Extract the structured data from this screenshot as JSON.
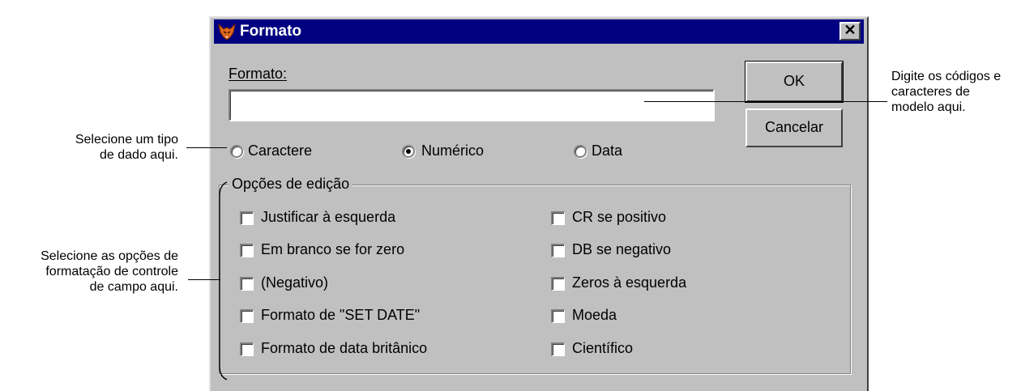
{
  "dialog": {
    "title": "Formato",
    "close_glyph": "✕",
    "format_label": "Formato:",
    "format_value": "",
    "ok_label": "OK",
    "cancel_label": "Cancelar",
    "radios": [
      {
        "label": "Caractere",
        "selected": false
      },
      {
        "label": "Numérico",
        "selected": true
      },
      {
        "label": "Data",
        "selected": false
      }
    ],
    "group_title": "Opções de edição",
    "options_left": [
      {
        "label": "Justificar à esquerda",
        "checked": false
      },
      {
        "label": "Em branco se for zero",
        "checked": false
      },
      {
        "label": "(Negativo)",
        "checked": false
      },
      {
        "label": "Formato de \"SET DATE\"",
        "checked": false
      },
      {
        "label": "Formato de data britânico",
        "checked": false
      }
    ],
    "options_right": [
      {
        "label": "CR se positivo",
        "checked": false
      },
      {
        "label": "DB se negativo",
        "checked": false
      },
      {
        "label": "Zeros à esquerda",
        "checked": false
      },
      {
        "label": "Moeda",
        "checked": false
      },
      {
        "label": "Científico",
        "checked": false
      }
    ]
  },
  "annotations": {
    "right": [
      "Digite os códigos e",
      "caracteres de",
      "modelo aqui."
    ],
    "left_top": [
      "Selecione um tipo",
      "de dado aqui."
    ],
    "left_bottom": [
      "Selecione as opções de",
      "formatação de controle",
      "de campo aqui."
    ]
  },
  "icons": {
    "app": "fox-icon",
    "close": "close-icon"
  }
}
